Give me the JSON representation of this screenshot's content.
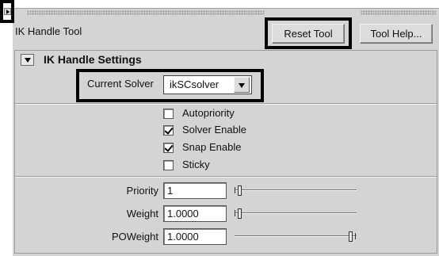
{
  "tool": {
    "title": "IK Handle Tool",
    "reset_label": "Reset Tool",
    "help_label": "Tool Help..."
  },
  "section": {
    "title": "IK Handle Settings",
    "solver_label": "Current Solver",
    "solver_value": "ikSCsolver"
  },
  "options": [
    {
      "label": "Autopriority",
      "checked": false
    },
    {
      "label": "Solver Enable",
      "checked": true
    },
    {
      "label": "Snap Enable",
      "checked": true
    },
    {
      "label": "Sticky",
      "checked": false
    }
  ],
  "fields": [
    {
      "label": "Priority",
      "value": "1",
      "slider_fraction": 0.0
    },
    {
      "label": "Weight",
      "value": "1.0000",
      "slider_fraction": 0.0
    },
    {
      "label": "POWeight",
      "value": "1.0000",
      "slider_fraction": 1.0
    }
  ],
  "icons": {
    "corner": "triangle-right-icon",
    "section_toggle": "triangle-down-icon",
    "dropdown": "dropdown-arrow-icon"
  }
}
